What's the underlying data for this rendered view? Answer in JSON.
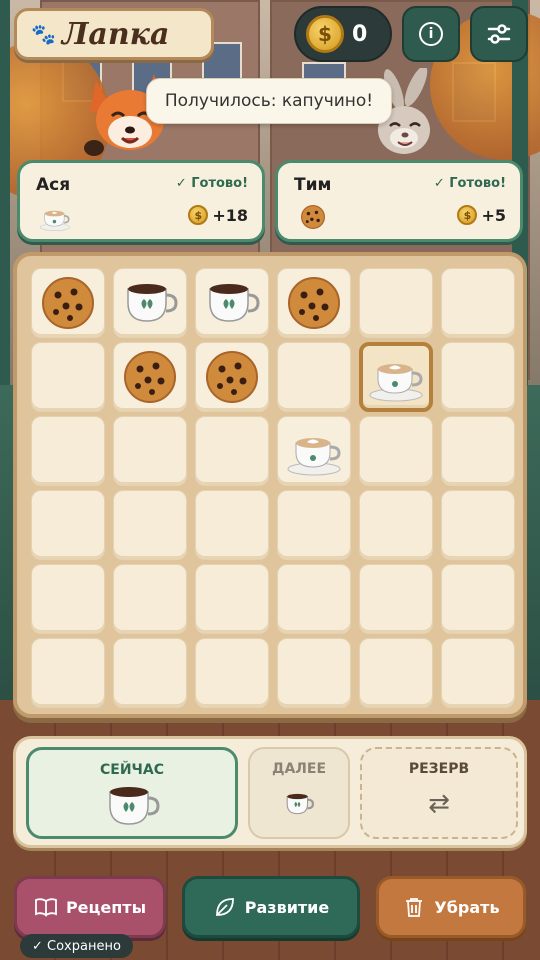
{
  "header": {
    "logo_title": "Лапка",
    "coins": "0"
  },
  "toast": "Получилось: капучино!",
  "orders": [
    {
      "name": "Ася",
      "status": "✓ Готово!",
      "item": "cappuccino",
      "reward": "+18"
    },
    {
      "name": "Тим",
      "status": "✓ Готово!",
      "item": "cookie",
      "reward": "+5"
    }
  ],
  "board": {
    "rows": 6,
    "cols": 6,
    "cells": [
      [
        "cookie",
        "coffee",
        "coffee",
        "cookie",
        "",
        ""
      ],
      [
        "",
        "cookie",
        "cookie",
        "",
        "cappuccino",
        ""
      ],
      [
        "",
        "",
        "",
        "cappuccino",
        "",
        ""
      ],
      [
        "",
        "",
        "",
        "",
        "",
        ""
      ],
      [
        "",
        "",
        "",
        "",
        "",
        ""
      ],
      [
        "",
        "",
        "",
        "",
        "",
        ""
      ]
    ],
    "selected": [
      1,
      4
    ]
  },
  "queue": {
    "now_label": "СЕЙЧАС",
    "now_item": "coffee",
    "next_label": "ДАЛЕЕ",
    "next_item": "coffee",
    "reserve_label": "РЕЗЕРВ"
  },
  "buttons": {
    "recipes": "Рецепты",
    "develop": "Развитие",
    "remove": "Убрать"
  },
  "saved": "✓ Сохранено",
  "colors": {
    "accent_green": "#2f6a58",
    "recipes_pink": "#a9506a",
    "remove_orange": "#c2783e",
    "coin_gold": "#d49a1f"
  }
}
